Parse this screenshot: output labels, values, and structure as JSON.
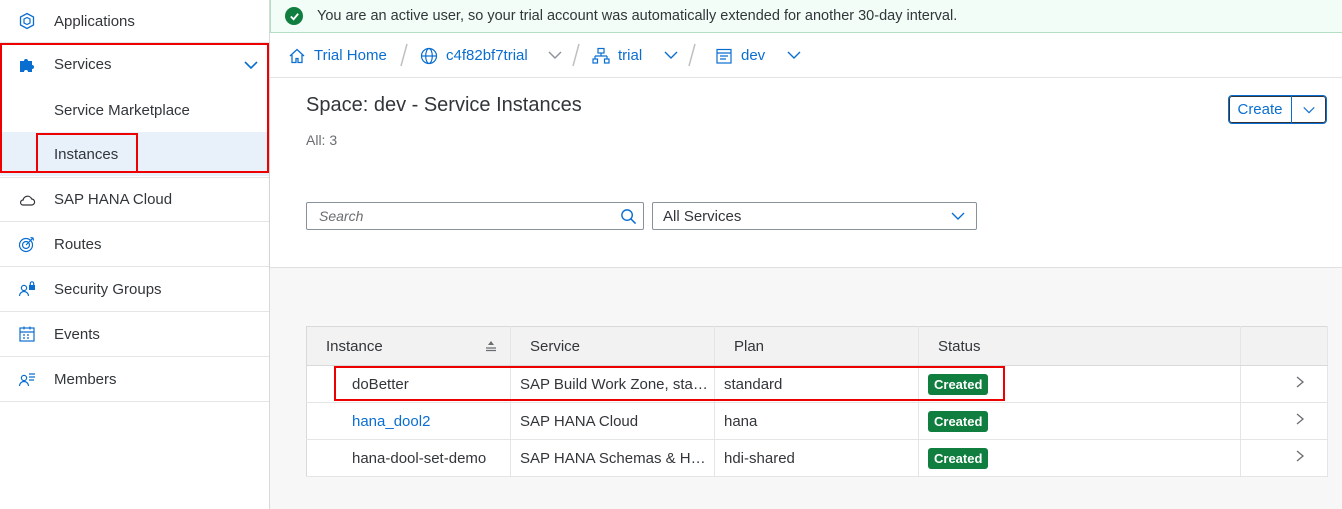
{
  "sidebar": {
    "items": [
      {
        "label": "Applications",
        "icon": "cube-icon"
      },
      {
        "label": "Services",
        "icon": "puzzle-icon",
        "expanded": true
      },
      {
        "label": "Service Marketplace"
      },
      {
        "label": "Instances",
        "selected": true
      },
      {
        "label": "SAP HANA Cloud",
        "icon": "cloud-icon"
      },
      {
        "label": "Routes",
        "icon": "target-icon"
      },
      {
        "label": "Security Groups",
        "icon": "users-lock-icon"
      },
      {
        "label": "Events",
        "icon": "calendar-icon"
      },
      {
        "label": "Members",
        "icon": "member-icon"
      }
    ]
  },
  "banner": {
    "text": "You are an active user, so your trial account was automatically extended for another 30-day interval."
  },
  "breadcrumb": {
    "home": "Trial Home",
    "subaccount": "c4f82bf7trial",
    "org": "trial",
    "space": "dev"
  },
  "header": {
    "title": "Space: dev - Service Instances",
    "count": "All: 3",
    "create_label": "Create",
    "search_placeholder": "Search",
    "filter_value": "All Services"
  },
  "table": {
    "columns": [
      "Instance",
      "Service",
      "Plan",
      "Status"
    ],
    "rows": [
      {
        "instance": "doBetter",
        "service": "SAP Build Work Zone, standard edition",
        "plan": "standard",
        "status": "Created",
        "link": false
      },
      {
        "instance": "hana_dool2",
        "service": "SAP HANA Cloud",
        "plan": "hana",
        "status": "Created",
        "link": true
      },
      {
        "instance": "hana-dool-set-demo",
        "service": "SAP HANA Schemas & HDI Containers",
        "plan": "hdi-shared",
        "status": "Created",
        "link": false
      }
    ]
  },
  "colors": {
    "accent": "#0a6ed1",
    "success": "#107e3e",
    "highlight": "#e00000"
  }
}
